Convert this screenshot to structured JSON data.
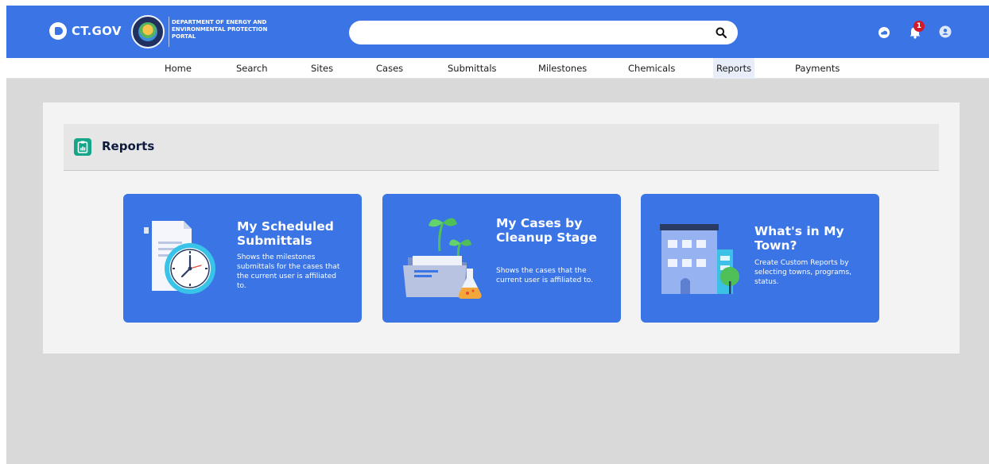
{
  "header": {
    "logo_text": "CT.GOV",
    "department": "DEPARTMENT OF ENERGY AND ENVIRONMENTAL PROTECTION PORTAL",
    "search_placeholder": "",
    "notification_count": "1",
    "colors": {
      "brand": "#3a74e5",
      "badge": "#d11a2a"
    }
  },
  "nav": {
    "items": [
      {
        "label": "Home"
      },
      {
        "label": "Search"
      },
      {
        "label": "Sites"
      },
      {
        "label": "Cases"
      },
      {
        "label": "Submittals"
      },
      {
        "label": "Milestones"
      },
      {
        "label": "Chemicals"
      },
      {
        "label": "Reports",
        "active": true
      },
      {
        "label": "Payments"
      }
    ]
  },
  "reports": {
    "title": "Reports",
    "icon": "clipboard-chart-icon",
    "tiles": [
      {
        "title": "My Scheduled Submittals",
        "description": "Shows the milestones submittals for the cases that the current user is affiliated to.",
        "icon": "document-clock-icon"
      },
      {
        "title": "My Cases by Cleanup Stage",
        "description": "Shows the cases that the current user is affiliated to.",
        "icon": "folder-sprout-icon"
      },
      {
        "title": "What's in My Town?",
        "description": "Create Custom Reports by selecting towns, programs, status.",
        "icon": "building-tree-icon"
      }
    ]
  }
}
